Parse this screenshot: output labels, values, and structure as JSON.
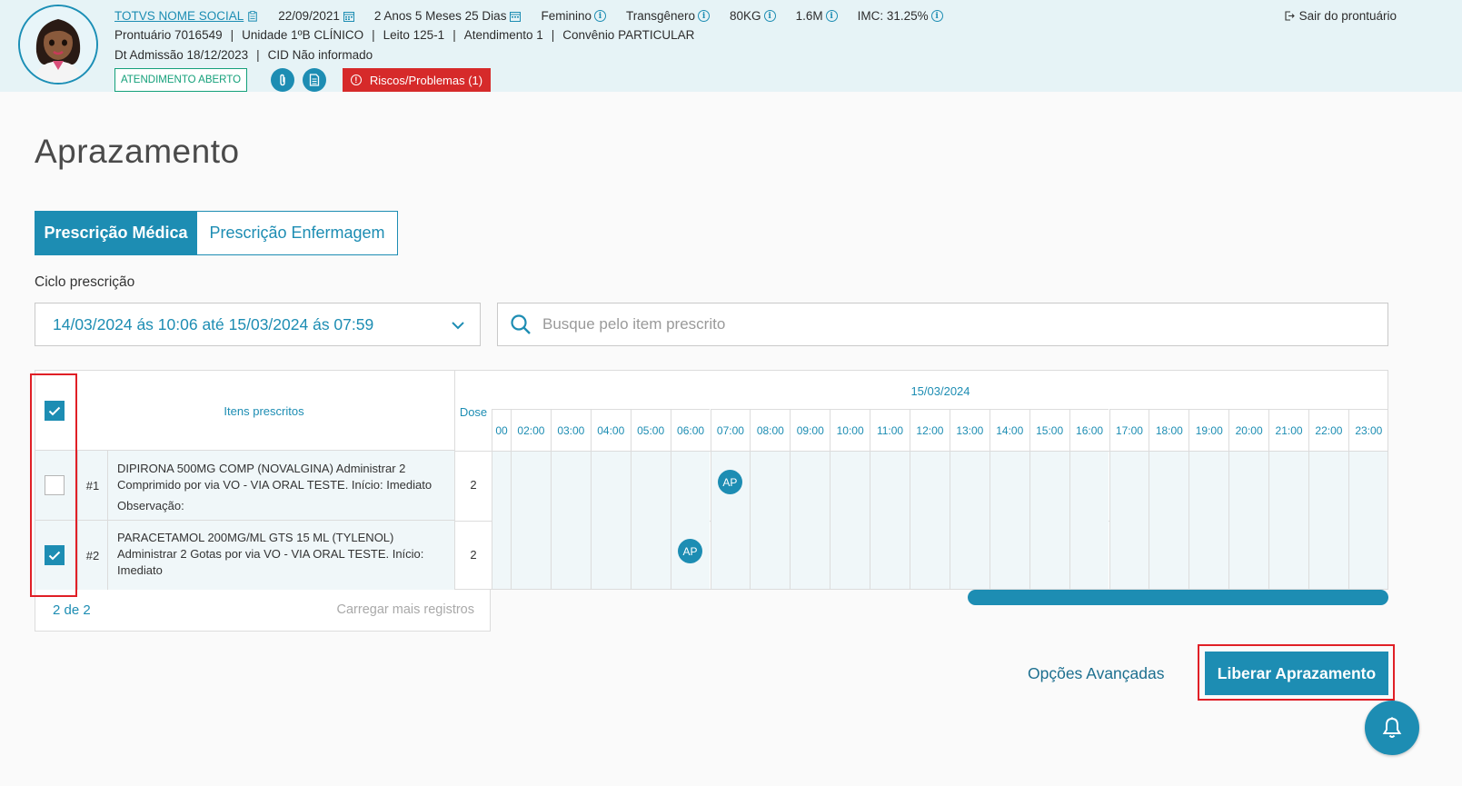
{
  "header": {
    "patient_name": "TOTVS NOME SOCIAL",
    "birth_date": "22/09/2021",
    "age": "2 Anos 5 Meses 25 Dias",
    "sex": "Feminino",
    "gender": "Transgênero",
    "weight": "80KG",
    "height": "1.6M",
    "imc": "IMC: 31.25%",
    "prontuario": "Prontuário 7016549",
    "unidade": "Unidade 1ºB CLÍNICO",
    "leito": "Leito 125-1",
    "atendimento": "Atendimento 1",
    "convenio": "Convênio PARTICULAR",
    "admissao": "Dt Admissão 18/12/2023",
    "cid": "CID Não informado",
    "status_badge": "ATENDIMENTO ABERTO",
    "risks_button": "Riscos/Problemas (1)",
    "exit_label": "Sair do prontuário"
  },
  "page": {
    "title": "Aprazamento"
  },
  "tabs": [
    {
      "label": "Prescrição Médica",
      "active": true
    },
    {
      "label": "Prescrição Enfermagem",
      "active": false
    }
  ],
  "filters": {
    "cycle_label": "Ciclo prescrição",
    "cycle_value": "14/03/2024 ás 10:06 até 15/03/2024 ás 07:59",
    "search_placeholder": "Busque pelo item prescrito"
  },
  "table": {
    "items_header": "Itens prescritos",
    "dose_header": "Dose",
    "date_header": "15/03/2024",
    "hours": [
      "00",
      "02:00",
      "03:00",
      "04:00",
      "05:00",
      "06:00",
      "07:00",
      "08:00",
      "09:00",
      "10:00",
      "11:00",
      "12:00",
      "13:00",
      "14:00",
      "15:00",
      "16:00",
      "17:00",
      "18:00",
      "19:00",
      "20:00",
      "21:00",
      "22:00",
      "23:00"
    ],
    "header_checked": true,
    "rows": [
      {
        "checked": false,
        "number": "#1",
        "description": "DIPIRONA 500MG COMP (NOVALGINA) Administrar 2 Comprimido por via VO - VIA ORAL TESTE. Início: Imediato",
        "observation": "Observação:",
        "dose": "2",
        "schedule_label": "AP",
        "schedule_hour": "07:00"
      },
      {
        "checked": true,
        "number": "#2",
        "description": "PARACETAMOL 200MG/ML GTS 15 ML (TYLENOL) Administrar 2 Gotas por via VO - VIA ORAL TESTE. Início: Imediato",
        "observation": "",
        "dose": "2",
        "schedule_label": "AP",
        "schedule_hour": "06:00"
      }
    ],
    "count": "2 de 2",
    "load_more": "Carregar mais registros"
  },
  "actions": {
    "advanced": "Opções Avançadas",
    "release": "Liberar Aprazamento"
  },
  "colors": {
    "primary": "#1d8db3",
    "header_bg": "#e6f3f6",
    "danger": "#d62a2a",
    "success": "#14a07a",
    "highlight": "#e01f26"
  },
  "icons": [
    "calendar-icon",
    "info-icon",
    "exit-icon",
    "clip-icon",
    "document-icon",
    "alert-icon",
    "chevron-down-icon",
    "search-icon",
    "check-icon",
    "bell-icon"
  ]
}
